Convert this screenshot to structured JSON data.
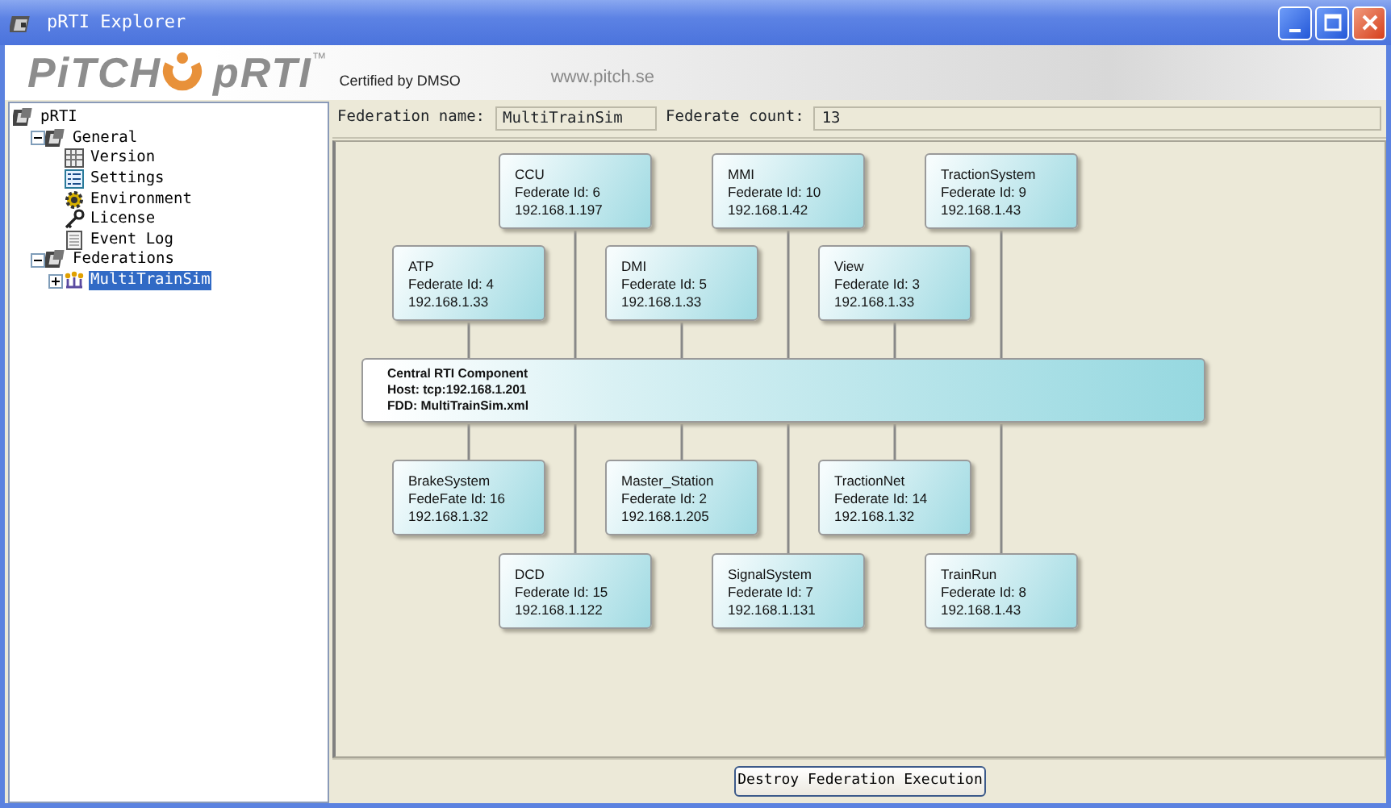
{
  "window": {
    "title": "pRTI Explorer"
  },
  "banner": {
    "logo_text": "PiTCH",
    "product": "pRTI",
    "trademark": "™",
    "certified": "Certified by DMSO",
    "url": "www.pitch.se"
  },
  "tree": [
    {
      "label": "pRTI",
      "kind": "root",
      "selected": false,
      "children": [
        {
          "label": "General",
          "kind": "folder",
          "selected": false,
          "expanded": true,
          "children": [
            {
              "label": "Version",
              "kind": "version",
              "selected": false
            },
            {
              "label": "Settings",
              "kind": "settings",
              "selected": false
            },
            {
              "label": "Environment",
              "kind": "environment",
              "selected": false
            },
            {
              "label": "License",
              "kind": "license",
              "selected": false
            },
            {
              "label": "Event Log",
              "kind": "log",
              "selected": false
            }
          ]
        },
        {
          "label": "Federations",
          "kind": "folder",
          "selected": false,
          "expanded": true,
          "children": [
            {
              "label": "MultiTrainSim",
              "kind": "federation",
              "selected": true,
              "expanded": false
            }
          ]
        }
      ]
    }
  ],
  "fields": [
    {
      "label": "Federation name:",
      "value": "MultiTrainSim"
    },
    {
      "label": "Federate count:",
      "value": "13"
    }
  ],
  "diagram": {
    "central": {
      "title": "Central RTI Component",
      "host": "Host: tcp:192.168.1.201",
      "fdd": "FDD: MultiTrainSim.xml"
    },
    "federates": [
      {
        "name": "CCU",
        "id": "Federate Id: 6",
        "ip": "192.168.1.197"
      },
      {
        "name": "MMI",
        "id": "Federate Id: 10",
        "ip": "192.168.1.42"
      },
      {
        "name": "TractionSystem",
        "id": "Federate Id: 9",
        "ip": "192.168.1.43"
      },
      {
        "name": "ATP",
        "id": "Federate Id: 4",
        "ip": "192.168.1.33"
      },
      {
        "name": "DMI",
        "id": "Federate Id: 5",
        "ip": "192.168.1.33"
      },
      {
        "name": "View",
        "id": "Federate Id: 3",
        "ip": "192.168.1.33"
      },
      {
        "name": "BrakeSystem",
        "id": "FedeFate Id: 16",
        "ip": "192.168.1.32"
      },
      {
        "name": "Master_Station",
        "id": "Federate Id: 2",
        "ip": "192.168.1.205"
      },
      {
        "name": "TractionNet",
        "id": "Federate Id: 14",
        "ip": "192.168.1.32"
      },
      {
        "name": "DCD",
        "id": "Federate Id: 15",
        "ip": "192.168.1.122"
      },
      {
        "name": "SignalSystem",
        "id": "Federate Id: 7",
        "ip": "192.168.1.131"
      },
      {
        "name": "TrainRun",
        "id": "Federate Id: 8",
        "ip": "192.168.1.43"
      }
    ]
  },
  "buttons": [
    "Destroy Federation Execution"
  ]
}
